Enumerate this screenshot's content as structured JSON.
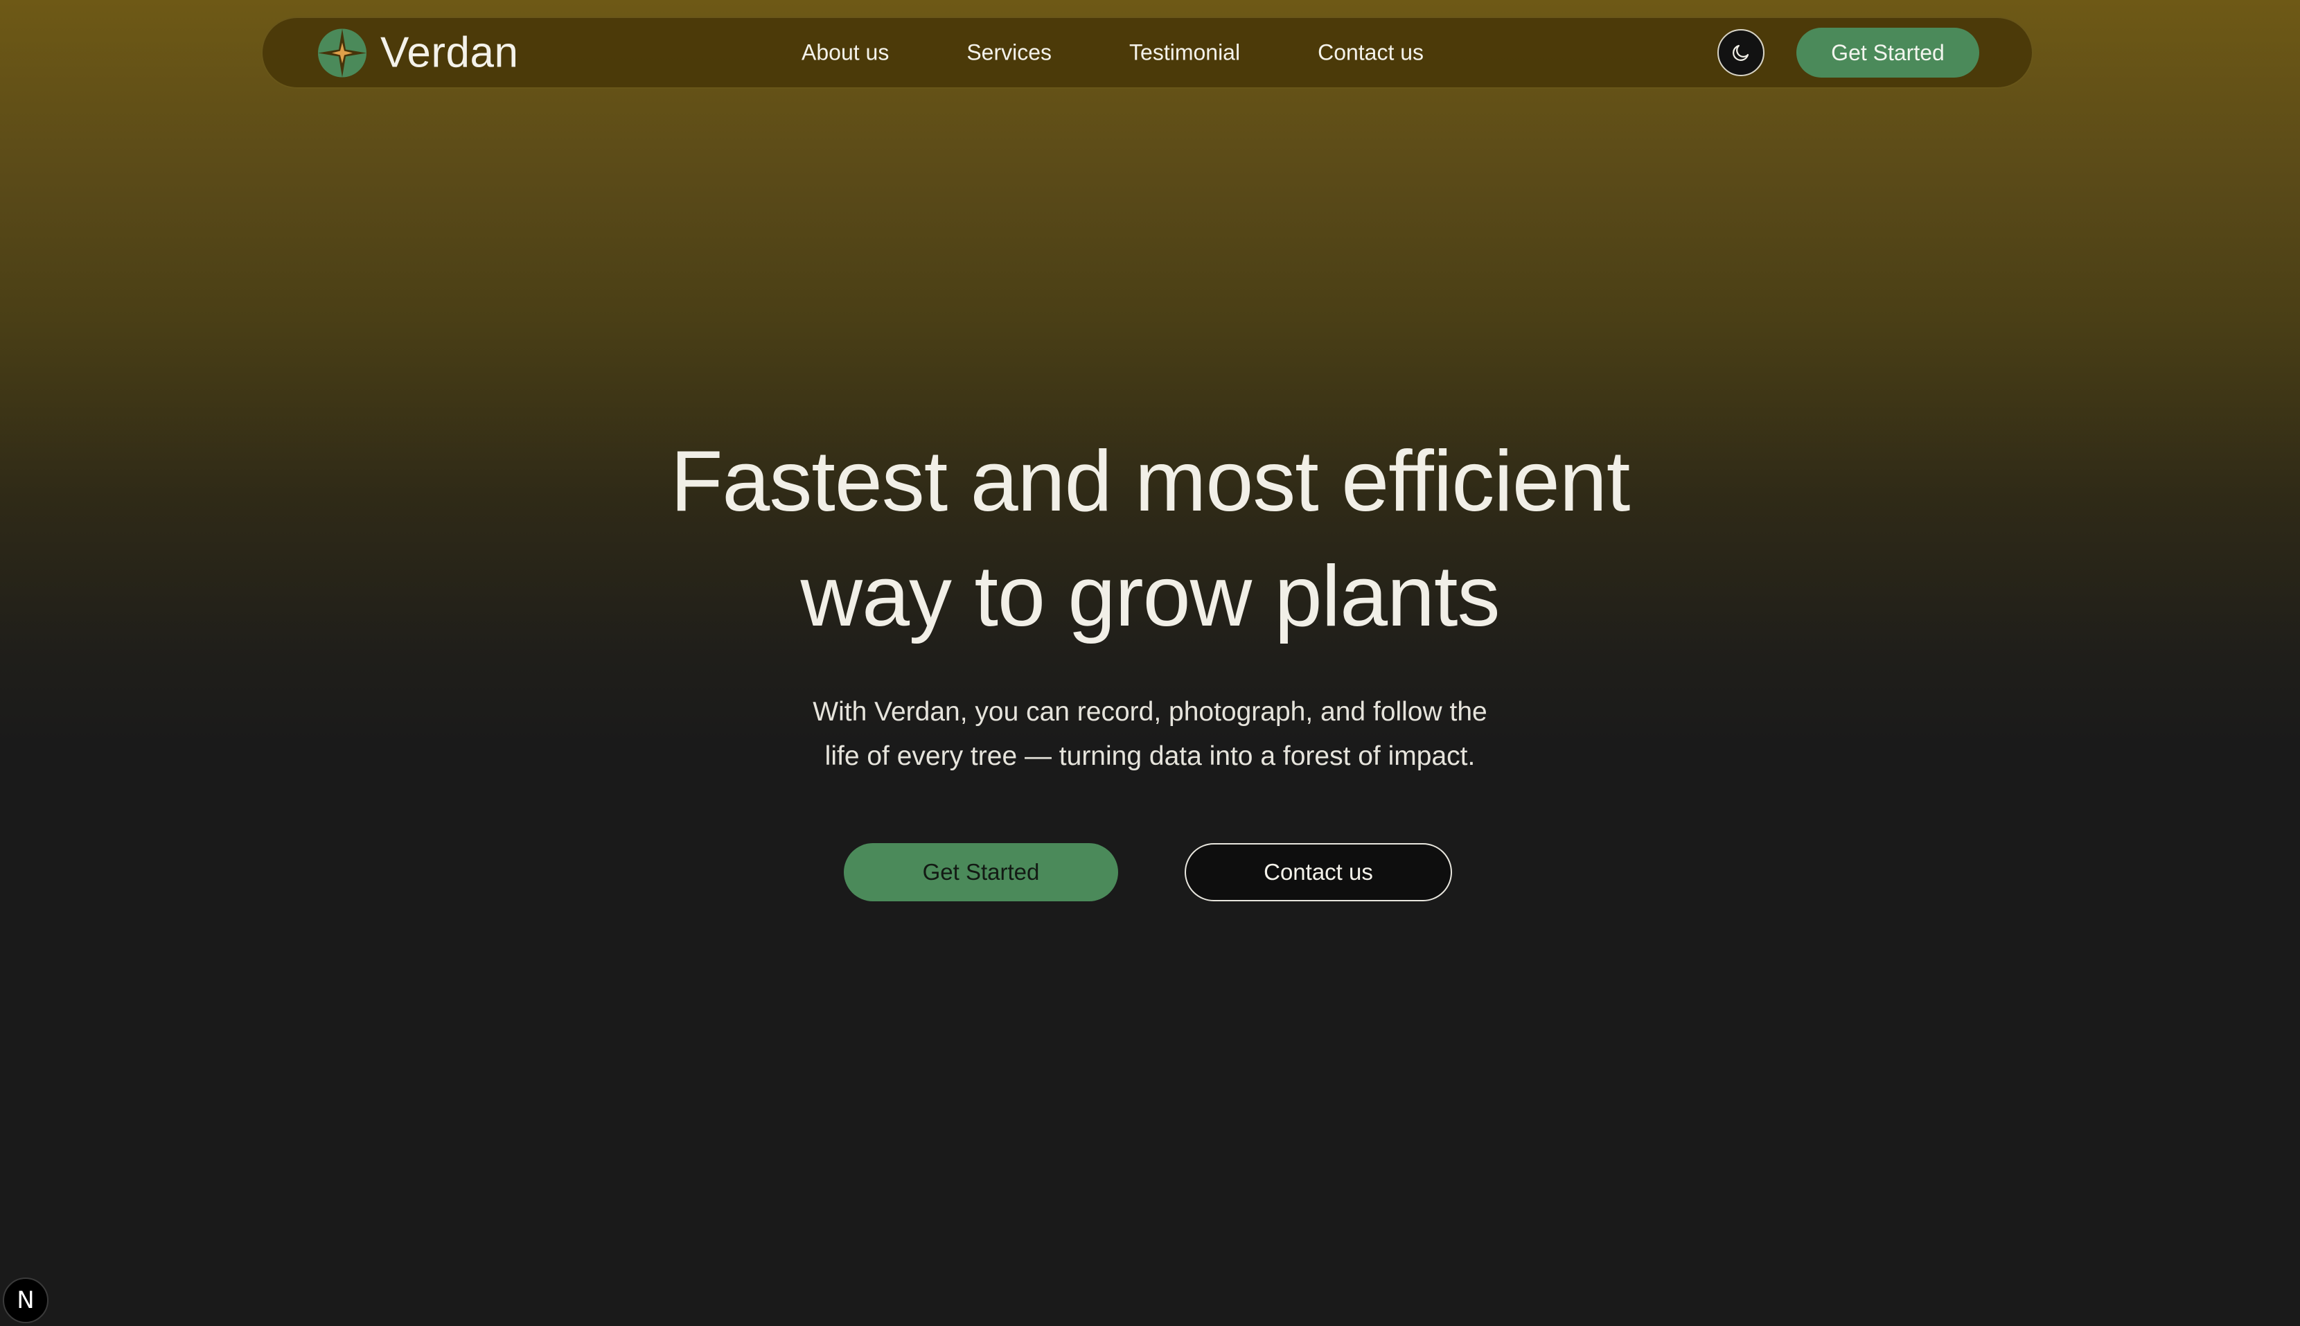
{
  "brand": {
    "name": "Verdan",
    "logo_icon": "leaf-star-logo-icon"
  },
  "nav": {
    "links": [
      "About us",
      "Services",
      "Testimonial",
      "Contact us"
    ],
    "theme_toggle_icon": "moon-icon",
    "cta_label": "Get Started"
  },
  "hero": {
    "title_line1": "Fastest and most efficient",
    "title_line2": "way to grow plants",
    "subtitle_line1": "With Verdan, you can record, photograph, and follow the",
    "subtitle_line2": "life of every tree — turning data into a forest of impact.",
    "primary_button": "Get Started",
    "secondary_button": "Contact us"
  },
  "corner_badge": {
    "label": "N",
    "icon": "nextjs-icon"
  },
  "colors": {
    "accent_green": "#4b8a5a",
    "nav_background": "#46340a",
    "page_background": "#1a1a1a",
    "gradient_top": "#6e5916"
  }
}
